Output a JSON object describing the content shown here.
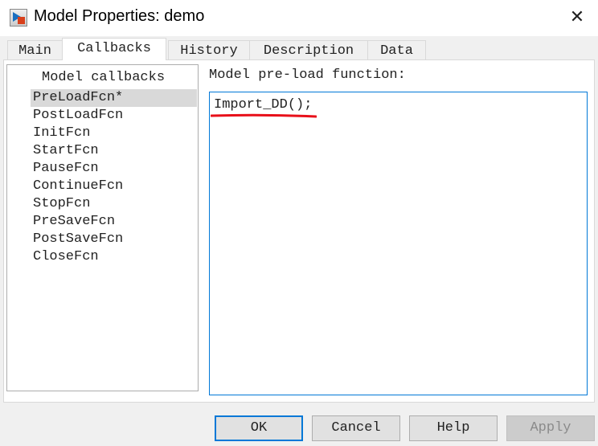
{
  "window": {
    "title": "Model Properties: demo",
    "close_icon": "close-icon"
  },
  "tabs": [
    {
      "label": "Main"
    },
    {
      "label": "Callbacks",
      "active": true
    },
    {
      "label": "History"
    },
    {
      "label": "Description"
    },
    {
      "label": "Data"
    }
  ],
  "callbacks": {
    "header": "Model callbacks",
    "selected": "PreLoadFcn*",
    "items": [
      "PreLoadFcn*",
      "PostLoadFcn",
      "InitFcn",
      "StartFcn",
      "PauseFcn",
      "ContinueFcn",
      "StopFcn",
      "PreSaveFcn",
      "PostSaveFcn",
      "CloseFcn"
    ]
  },
  "editor": {
    "label": "Model pre-load function:",
    "value": "Import_DD();",
    "annotation_color": "#e8101a"
  },
  "buttons": {
    "ok": "OK",
    "cancel": "Cancel",
    "help": "Help",
    "apply": "Apply"
  }
}
